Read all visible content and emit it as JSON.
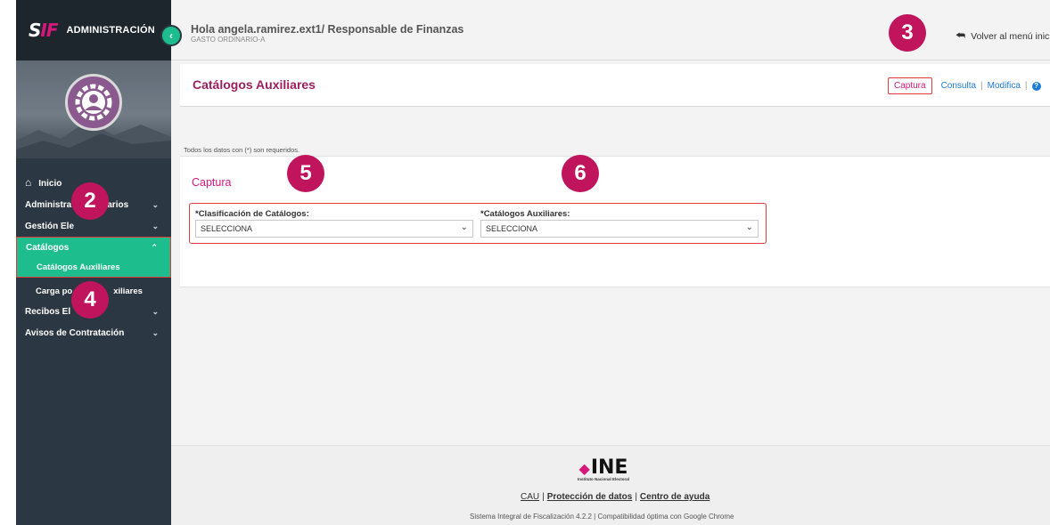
{
  "sidebar": {
    "logo": {
      "mark_left": "S",
      "mark_right": "IF",
      "title": "ADMINISTRACIÓN"
    },
    "collapse_icon": "‹",
    "items": [
      {
        "label": "Inicio",
        "icon": "home-icon"
      },
      {
        "label": "Administración de Usuarios",
        "shown": "Administra"
      },
      {
        "label": "Gestión Ele"
      },
      {
        "label": "Catálogos"
      },
      {
        "label": "Catálogos Auxiliares"
      },
      {
        "label": "Carga po"
      },
      {
        "label": "Recibos El"
      },
      {
        "label": "Avisos de Contratación"
      }
    ],
    "sub_tail": "xiliares",
    "admin_tail": "arios"
  },
  "header": {
    "greeting": "Hola angela.ramirez.ext1/ Responsable de Finanzas",
    "subtitle": "GASTO ORDINARIO-A",
    "back_label": "Volver al menú inic"
  },
  "titlebar": {
    "title": "Catálogos Auxiliares",
    "actions": [
      "Captura",
      "Consulta",
      "Modifica"
    ],
    "help_icon": "?"
  },
  "content": {
    "required_note": "Todos los datos con (*) son requeridos.",
    "section_title": "Captura",
    "fields": [
      {
        "label": "*Clasificación de Catálogos:",
        "value": "SELECCIONA"
      },
      {
        "label": "*Catálogos Auxiliares:",
        "value": "SELECCIONA"
      }
    ]
  },
  "footer": {
    "logo_text": "INE",
    "logo_sub": "Instituto Nacional Electoral",
    "links": [
      "CAU",
      "Protección de datos",
      "Centro de ayuda"
    ],
    "system_text": "Sistema Integral de Fiscalización 4.2.2 | Compatibilidad óptima con Google Chrome"
  },
  "badges": [
    "2",
    "3",
    "4",
    "5",
    "6"
  ],
  "colors": {
    "accent": "#d5187a",
    "active_menu": "#1ebd8e",
    "sidebar": "#2b3742",
    "badge": "#c0145d",
    "link": "#1e7ad9"
  }
}
